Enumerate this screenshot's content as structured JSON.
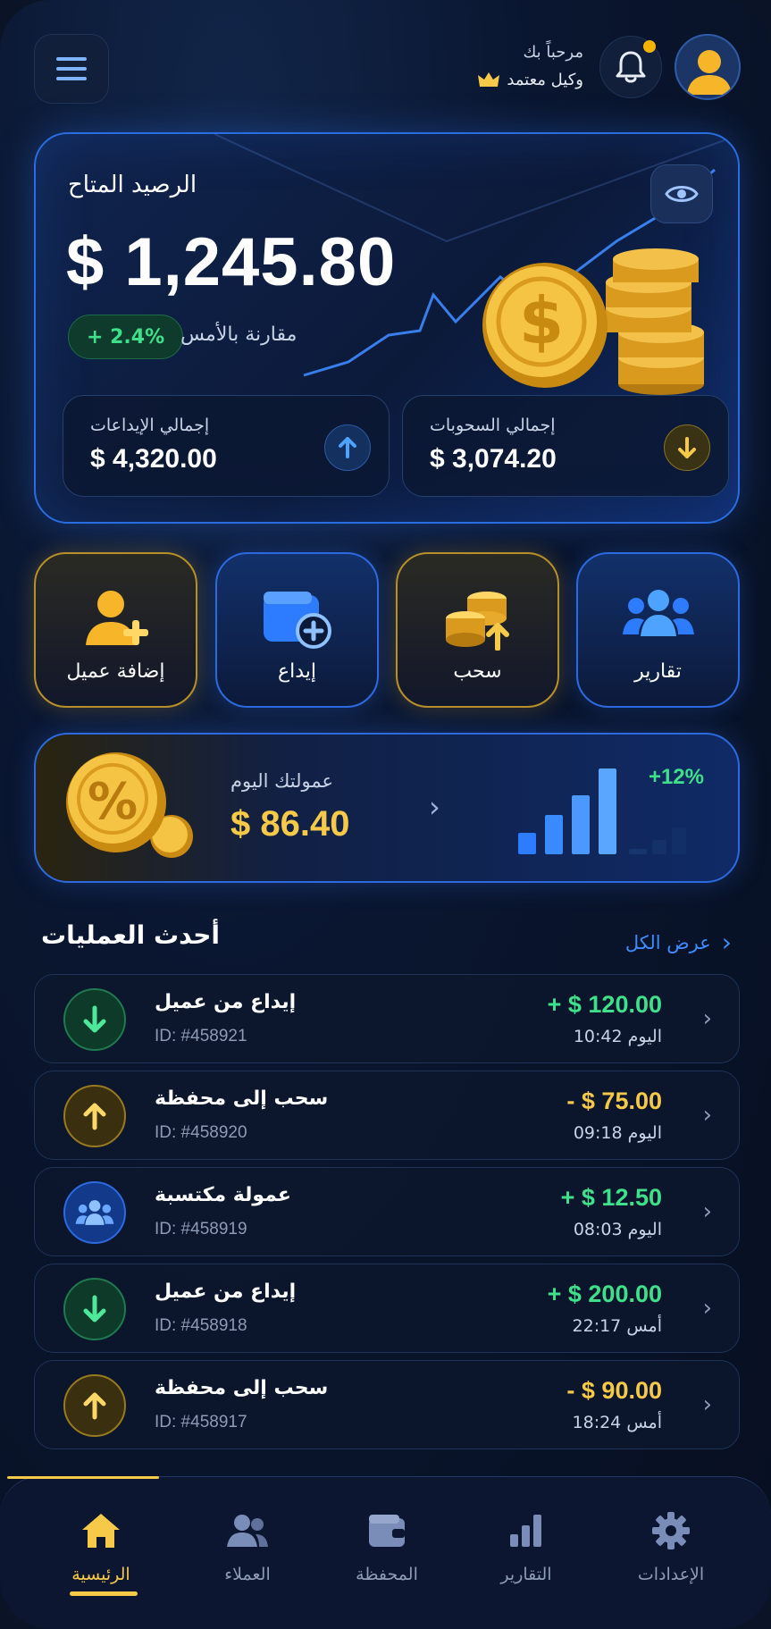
{
  "header": {
    "greeting": "مرحباً بك",
    "role": "وكيل معتمد",
    "menu_icon": "hamburger-icon",
    "bell_icon": "bell-icon",
    "avatar_icon": "user-avatar-icon"
  },
  "balance": {
    "label": "الرصيد المتاح",
    "amount": "$ 1,245.80",
    "change": "+ 2.4%",
    "change_label": "مقارنة بالأمس",
    "deposits_label": "إجمالي الإيداعات",
    "deposits_value": "$ 4,320.00",
    "withdrawals_label": "إجمالي السحوبات",
    "withdrawals_value": "$ 3,074.20"
  },
  "actions": [
    {
      "label": "إضافة عميل",
      "icon": "add-user-icon"
    },
    {
      "label": "إيداع",
      "icon": "wallet-plus-icon"
    },
    {
      "label": "سحب",
      "icon": "coins-up-icon"
    },
    {
      "label": "تقارير",
      "icon": "users-group-icon"
    }
  ],
  "commission": {
    "label": "عمولتك اليوم",
    "value": "$ 86.40",
    "change": "+12%"
  },
  "transactions_section": {
    "title": "أحدث العمليات",
    "view_all": "عرض الكل"
  },
  "transactions": [
    {
      "name": "إيداع من عميل",
      "id": "ID: #458921",
      "amount": "+ $ 120.00",
      "time": "اليوم 10:42",
      "type": "deposit"
    },
    {
      "name": "سحب إلى محفظة",
      "id": "ID: #458920",
      "amount": "- $ 75.00",
      "time": "اليوم 09:18",
      "type": "withdraw"
    },
    {
      "name": "عمولة مكتسبة",
      "id": "ID: #458919",
      "amount": "+ $ 12.50",
      "time": "اليوم 08:03",
      "type": "commission"
    },
    {
      "name": "إيداع من عميل",
      "id": "ID: #458918",
      "amount": "+ $ 200.00",
      "time": "أمس 22:17",
      "type": "deposit"
    },
    {
      "name": "سحب إلى محفظة",
      "id": "ID: #458917",
      "amount": "- $ 90.00",
      "time": "أمس 18:24",
      "type": "withdraw"
    }
  ],
  "nav": [
    {
      "label": "الرئيسية",
      "icon": "home-icon",
      "active": true
    },
    {
      "label": "العملاء",
      "icon": "users-icon"
    },
    {
      "label": "المحفظة",
      "icon": "wallet-icon"
    },
    {
      "label": "التقارير",
      "icon": "bar-chart-icon"
    },
    {
      "label": "الإعدادات",
      "icon": "gear-icon"
    }
  ],
  "colors": {
    "accent_blue": "#2d6ae0",
    "gold": "#f7c948",
    "positive": "#3ee08a",
    "background": "#0a1426"
  }
}
